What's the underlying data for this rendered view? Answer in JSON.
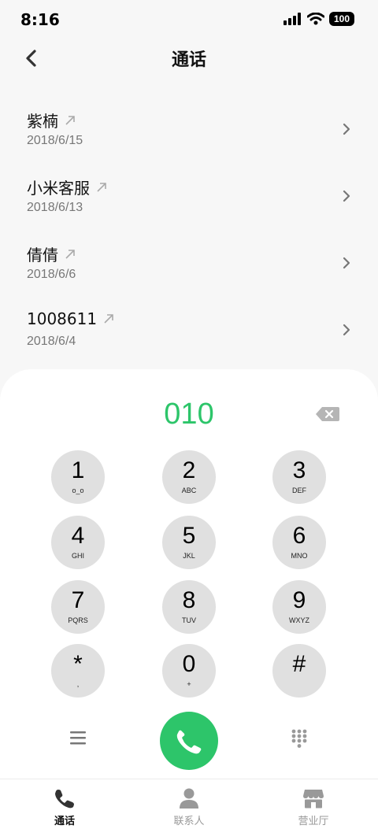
{
  "status_bar": {
    "time": "8:16",
    "battery": "100"
  },
  "nav": {
    "title": "通话"
  },
  "calls": [
    {
      "name": "紫楠",
      "date": "2018/6/15"
    },
    {
      "name": "小米客服",
      "date": "2018/6/13"
    },
    {
      "name": "倩倩",
      "date": "2018/6/6"
    },
    {
      "name": "1008611",
      "date": "2018/6/4"
    }
  ],
  "dialer": {
    "display": "010",
    "keys": [
      {
        "digit": "1",
        "letters": "o_o"
      },
      {
        "digit": "2",
        "letters": "ABC"
      },
      {
        "digit": "3",
        "letters": "DEF"
      },
      {
        "digit": "4",
        "letters": "GHI"
      },
      {
        "digit": "5",
        "letters": "JKL"
      },
      {
        "digit": "6",
        "letters": "MNO"
      },
      {
        "digit": "7",
        "letters": "PQRS"
      },
      {
        "digit": "8",
        "letters": "TUV"
      },
      {
        "digit": "9",
        "letters": "WXYZ"
      },
      {
        "digit": "*",
        "letters": ","
      },
      {
        "digit": "0",
        "letters": "+"
      },
      {
        "digit": "#",
        "letters": ""
      }
    ]
  },
  "tabs": [
    {
      "label": "通话",
      "icon": "phone-icon",
      "active": true
    },
    {
      "label": "联系人",
      "icon": "person-icon",
      "active": false
    },
    {
      "label": "营业厅",
      "icon": "store-icon",
      "active": false
    }
  ],
  "colors": {
    "accent": "#2dc56a",
    "key_bg": "#e0e0e0",
    "muted": "#999999"
  }
}
